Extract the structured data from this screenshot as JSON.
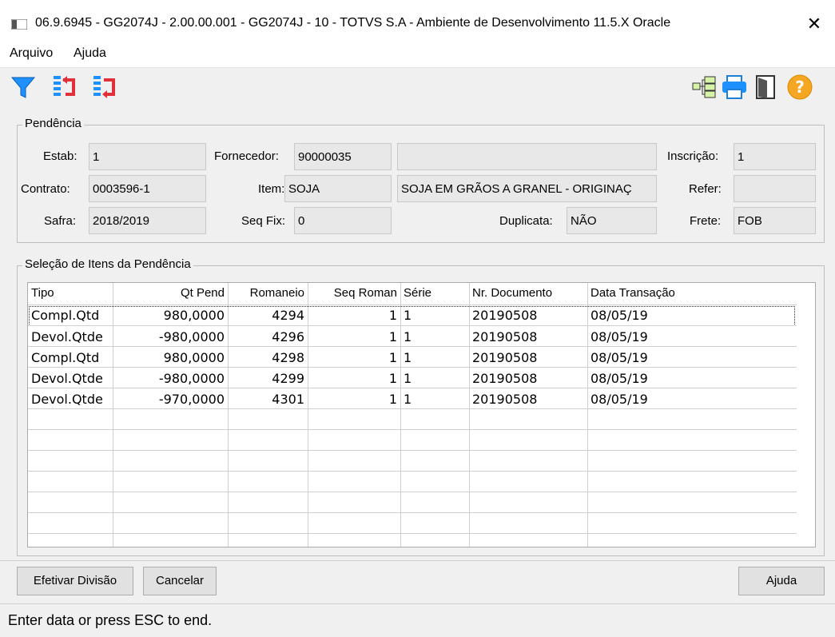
{
  "window": {
    "title": "06.9.6945 - GG2074J - 2.00.00.001 - GG2074J - 10 - TOTVS S.A - Ambiente de Desenvolvimento 11.5.X Oracle",
    "close_glyph": "✕"
  },
  "menu": {
    "items": [
      "Arquivo",
      "Ajuda"
    ]
  },
  "toolbar": {
    "left_icons": [
      "filter-icon",
      "swap-left-icon",
      "swap-right-icon"
    ],
    "right_icons": [
      "hierarchy-icon",
      "printer-icon",
      "exit-door-icon",
      "help-icon"
    ]
  },
  "pendencia": {
    "legend": "Pendência",
    "estab_label": "Estab:",
    "estab": "1",
    "fornecedor_label": "Fornecedor:",
    "fornecedor": "90000035",
    "fornecedor_nome": "",
    "inscricao_label": "Inscrição:",
    "inscricao": "1",
    "contrato_label": "Contrato:",
    "contrato": "0003596-1",
    "item_label": "Item:",
    "item": "SOJA",
    "item_desc": "SOJA EM GRÃOS A GRANEL - ORIGINAÇ",
    "refer_label": "Refer:",
    "refer": "",
    "safra_label": "Safra:",
    "safra": "2018/2019",
    "seqfix_label": "Seq Fix:",
    "seqfix": "0",
    "duplicata_label": "Duplicata:",
    "duplicata": "NÃO",
    "frete_label": "Frete:",
    "frete": "FOB"
  },
  "selecao": {
    "legend": "Seleção de Itens da Pendência",
    "columns": [
      "Tipo",
      "Qt Pend",
      "Romaneio",
      "Seq Roman",
      "Série",
      "Nr. Documento",
      "Data Transação"
    ],
    "rows": [
      [
        "Compl.Qtd",
        "980,0000",
        "4294",
        "1",
        "1",
        "20190508",
        "08/05/19"
      ],
      [
        "Devol.Qtde",
        "-980,0000",
        "4296",
        "1",
        "1",
        "20190508",
        "08/05/19"
      ],
      [
        "Compl.Qtd",
        "980,0000",
        "4298",
        "1",
        "1",
        "20190508",
        "08/05/19"
      ],
      [
        "Devol.Qtde",
        "-980,0000",
        "4299",
        "1",
        "1",
        "20190508",
        "08/05/19"
      ],
      [
        "Devol.Qtde",
        "-970,0000",
        "4301",
        "1",
        "1",
        "20190508",
        "08/05/19"
      ]
    ]
  },
  "buttons": {
    "efetivar": "Efetivar Divisão",
    "cancelar": "Cancelar",
    "ajuda": "Ajuda"
  },
  "status": {
    "text": "Enter data or press ESC to end."
  }
}
